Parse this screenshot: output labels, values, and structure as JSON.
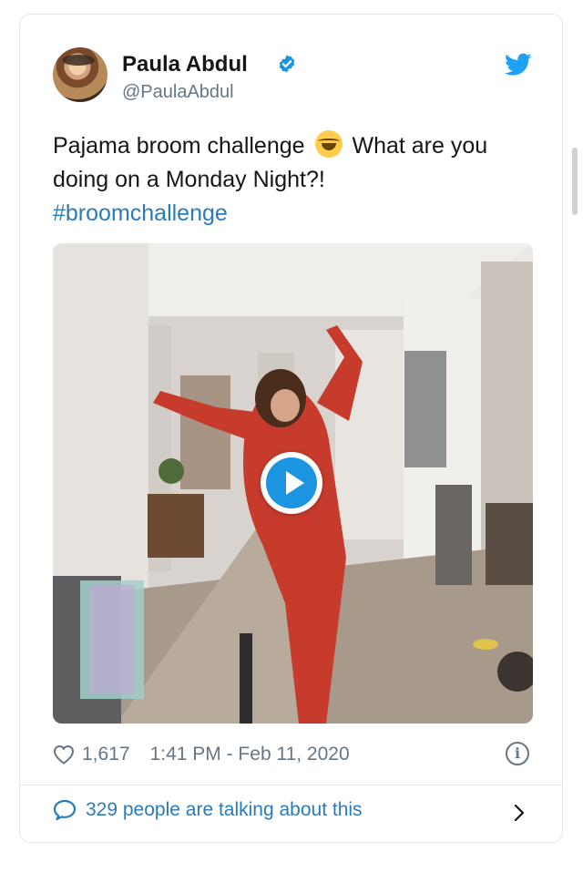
{
  "author": {
    "name": "Paula Abdul",
    "handle": "@PaulaAbdul",
    "verified": true
  },
  "tweet": {
    "text_part1": "Pajama broom challenge",
    "emoji": "face-with-tears-of-joy",
    "text_part2": "What are you doing on a Monday Night?!",
    "hashtag": "#broomchallenge"
  },
  "media": {
    "type": "video",
    "play_icon": "play-icon"
  },
  "stats": {
    "likes": "1,617",
    "timestamp": "1:41 PM - Feb 11, 2020",
    "info_symbol": "i"
  },
  "footer": {
    "talking": "329 people are talking about this"
  },
  "colors": {
    "link": "#2b7bb9",
    "verified": "#1b95e0",
    "muted": "#657786",
    "border": "#e1e8ed"
  }
}
